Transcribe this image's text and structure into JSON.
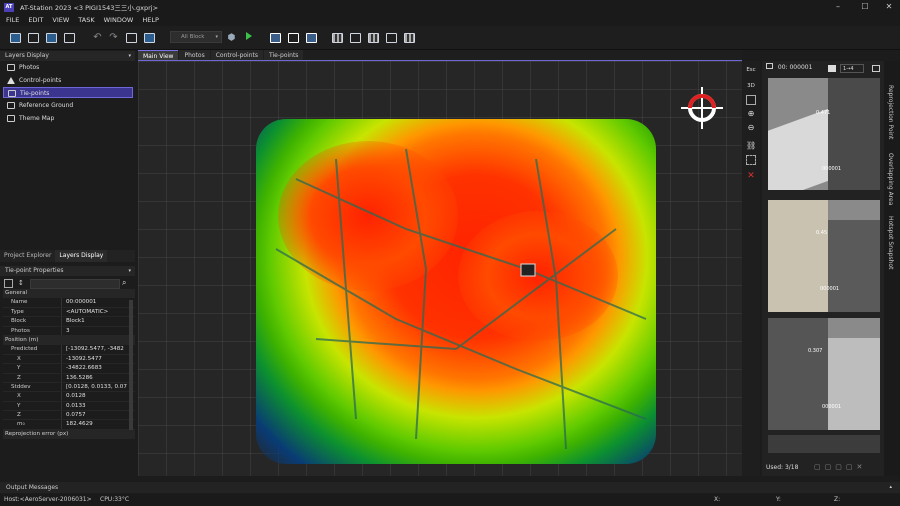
{
  "app": {
    "title": "AT-Station 2023 <3 PIGI1543三三小.gxprj>",
    "logo": "AT"
  },
  "window_controls": {
    "minimize": "–",
    "maximize": "☐",
    "close": "✕"
  },
  "menu": [
    "FILE",
    "EDIT",
    "VIEW",
    "TASK",
    "WINDOW",
    "HELP"
  ],
  "toolbar": {
    "block_select": "All Block"
  },
  "layers_display": {
    "title": "Layers Display",
    "items": [
      {
        "label": "Photos",
        "icon": "photo-icon",
        "selected": false
      },
      {
        "label": "Control-points",
        "icon": "triangle-icon",
        "selected": false
      },
      {
        "label": "Tie-points",
        "icon": "tiepoint-icon",
        "selected": true
      },
      {
        "label": "Reference Ground",
        "icon": "ground-icon",
        "selected": false
      },
      {
        "label": "Theme Map",
        "icon": "map-icon",
        "selected": false
      }
    ]
  },
  "left_tabs": [
    "Project Explorer",
    "Layers Display"
  ],
  "properties": {
    "title": "Tie-point Properties",
    "rows": [
      {
        "group": "General"
      },
      {
        "k": "Name",
        "v": "00:000001"
      },
      {
        "k": "Type",
        "v": "<AUTOMATIC>"
      },
      {
        "k": "Block",
        "v": "Block1"
      },
      {
        "k": "Photos",
        "v": "3"
      },
      {
        "group": "Position (m)"
      },
      {
        "k": "Predicted",
        "v": "[-13092.5477, -3482"
      },
      {
        "k": "X",
        "v": "-13092.5477",
        "sub": true
      },
      {
        "k": "Y",
        "v": "-34822.6683",
        "sub": true
      },
      {
        "k": "Z",
        "v": "136.5286",
        "sub": true
      },
      {
        "k": "Stddev",
        "v": "[0.0128, 0.0133, 0.07"
      },
      {
        "k": "X",
        "v": "0.0128",
        "sub": true
      },
      {
        "k": "Y",
        "v": "0.0133",
        "sub": true
      },
      {
        "k": "Z",
        "v": "0.0757",
        "sub": true
      },
      {
        "k": "m₀",
        "v": "182.4629",
        "sub": true
      },
      {
        "group": "Reprojection error (px)"
      }
    ]
  },
  "view_tabs": [
    "Main View",
    "Photos",
    "Control-points",
    "Tie-points"
  ],
  "view_tools": [
    "Esc",
    "3D"
  ],
  "right_panel": {
    "point_id": "00: 000001",
    "ratio": "1→4",
    "thumbs": [
      {
        "lbl_a": "0.471",
        "lbl_b": "000001"
      },
      {
        "lbl_a": "0.45",
        "lbl_b": "000001"
      },
      {
        "lbl_a": "0.307",
        "lbl_b": "000001"
      }
    ],
    "used": "Used: 3/18"
  },
  "side_tabs": [
    "Reprojection Point",
    "Overlapping Area",
    "Hotspot Snapshot"
  ],
  "output": {
    "label": "Output Messages"
  },
  "status": {
    "host": "Host:<AeroServer-2006031>",
    "cpu": "CPU:33°C",
    "x": "X:",
    "y": "Y:",
    "z": "Z:"
  },
  "colors": {
    "accent": "#6f66d8",
    "play": "#3cc24a",
    "close_red": "#e03030"
  }
}
